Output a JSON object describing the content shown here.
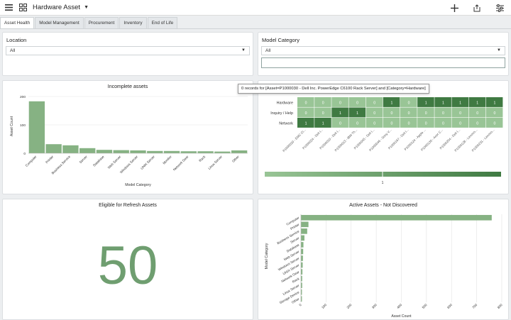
{
  "app": {
    "title": "Hardware Asset"
  },
  "tabs": [
    "Asset Health",
    "Model Management",
    "Procurement",
    "Inventory",
    "End of Life"
  ],
  "filters": {
    "location": {
      "label": "Location",
      "value": "All"
    },
    "model_category": {
      "label": "Model Category",
      "value": "All"
    }
  },
  "incomplete": {
    "title": "Incomplete assets",
    "chart_data": {
      "type": "bar",
      "categories": [
        "Computer",
        "Printer",
        "Business Service",
        "Server",
        "Database",
        "Web Server",
        "Windows Server",
        "UNIX Server",
        "Monitor",
        "Network Gear",
        "Rack",
        "Linux Server",
        "Other"
      ],
      "values": [
        183,
        32,
        28,
        18,
        12,
        11,
        10,
        8,
        8,
        7,
        7,
        6,
        10
      ],
      "xlabel": "Model Category",
      "ylabel": "Asset Count",
      "yticks": [
        "0",
        "100",
        "200"
      ],
      "ylim": [
        0,
        200
      ],
      "grid": true
    }
  },
  "heatmap": {
    "tooltip": "0 records for [Asset=P1000030 - Dell Inc. PowerEdge C6100 Rack Server] and [Category=Hardware]",
    "chart_data": {
      "type": "heatmap",
      "rows": [
        "Hardware",
        "Inquiry / Help",
        "Network"
      ],
      "columns": [
        "P1000020 - EMC Cl...",
        "P1000024 - Dell I...",
        "P1000010 - Dell I...",
        "P1000013 - IBM Th...",
        "P1000045 - Dell I...",
        "P1000046 - Sony V...",
        "P1000167 - Dell I...",
        "P1000124 - Apple ...",
        "P1000130 - Acer C...",
        "P1000204 - Dell I...",
        "P1000128 - Lenovo...",
        "P1000231 - Lenovo..."
      ],
      "values": [
        [
          0,
          0,
          0,
          0,
          0,
          1,
          0,
          1,
          1,
          1,
          1,
          1
        ],
        [
          0,
          0,
          1,
          1,
          0,
          0,
          0,
          0,
          0,
          0,
          0,
          0
        ],
        [
          1,
          1,
          0,
          0,
          0,
          0,
          0,
          0,
          0,
          0,
          0,
          0
        ]
      ],
      "legend_value": "1"
    }
  },
  "refresh": {
    "title": "Eligible for Refresh Assets",
    "value": "50"
  },
  "active": {
    "title": "Active Assets - Not Discovered",
    "chart_data": {
      "type": "bar",
      "orientation": "horizontal",
      "categories": [
        "Computer",
        "Printer",
        "Business Service",
        "Server",
        "Database",
        "Web Server",
        "Windows Server",
        "UNIX Server",
        "Network Gear",
        "Rack",
        "Linux Server",
        "Storage Device",
        "Other"
      ],
      "values": [
        760,
        30,
        25,
        14,
        10,
        9,
        8,
        7,
        6,
        5,
        5,
        4,
        4
      ],
      "xlabel": "Asset Count",
      "ylabel": "Model Category",
      "xticks": [
        "0",
        "100",
        "200",
        "300",
        "400",
        "500",
        "600",
        "700",
        "800"
      ],
      "xlim": [
        0,
        800
      ]
    }
  },
  "colors": {
    "bar": "#86b283",
    "grid": "#e2e2e2",
    "heat_low": "#99c596",
    "heat_high": "#3f7a42"
  }
}
